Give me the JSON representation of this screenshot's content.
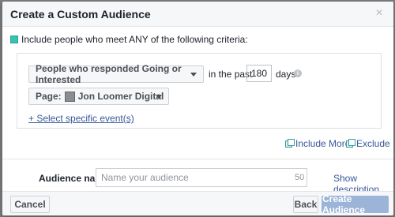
{
  "dialog": {
    "title": "Create a Custom Audience",
    "close_icon": "close-icon",
    "close_glyph": "×"
  },
  "criteria": {
    "text": "Include people who meet ANY of the following criteria:",
    "color": "#36c3b4"
  },
  "rule": {
    "event_select": "People who responded Going or Interested",
    "in_the_past": "in the past",
    "days_value": "180",
    "days_label": "days",
    "info_glyph": "i",
    "page_prefix": "Page:",
    "page_name": "Jon Loomer Digital",
    "select_events_link": "+ Select specific event(s)"
  },
  "actions": {
    "include_more": "Include More",
    "exclude": "Exclude"
  },
  "audience_name": {
    "label": "Audience name",
    "placeholder": "Name your audience",
    "char_limit": "50",
    "show_description": "Show description"
  },
  "footer": {
    "cancel": "Cancel",
    "back": "Back",
    "create": "Create Audience",
    "create_color": "#9cb4d8"
  }
}
